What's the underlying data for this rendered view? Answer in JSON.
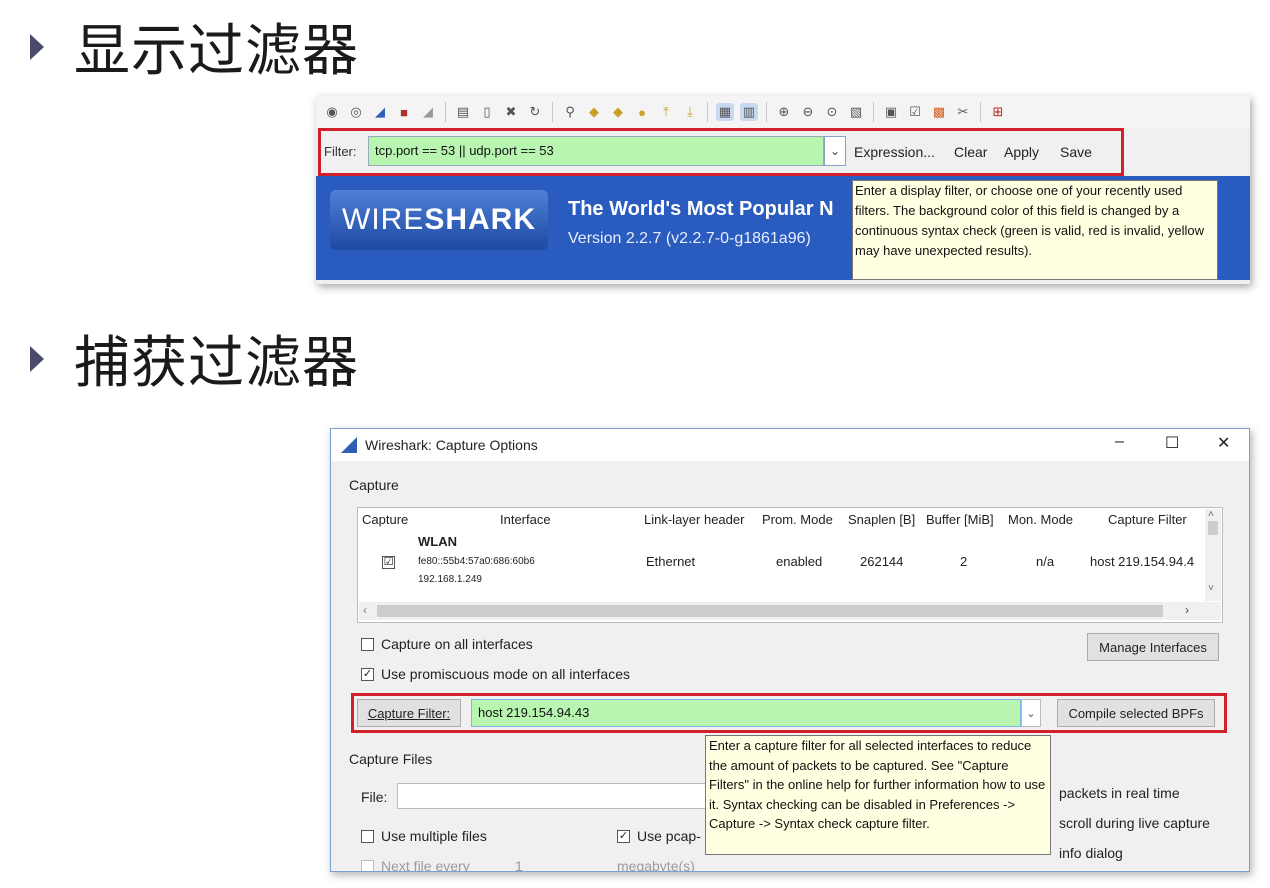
{
  "sections": {
    "display_filter_heading": "显示过滤器",
    "capture_filter_heading": "捕获过滤器"
  },
  "toolbar_icons": [
    "start-capture-icon",
    "options-icon",
    "shark-fin-icon",
    "stop-icon",
    "restart-icon",
    "open-file-icon",
    "file-icon",
    "close-file-icon",
    "reload-icon",
    "find-icon",
    "go-back-icon",
    "go-forward-icon",
    "go-to-packet-icon",
    "go-first-icon",
    "go-last-icon",
    "colorize-icon",
    "autoscroll-icon",
    "zoom-in-icon",
    "zoom-out-icon",
    "normal-size-icon",
    "resize-columns-icon",
    "capture-filters-icon",
    "display-filters-icon",
    "coloring-rules-icon",
    "preferences-icon",
    "help-icon"
  ],
  "display_filter_bar": {
    "label": "Filter:",
    "value": "tcp.port == 53 || udp.port == 53",
    "expression_button": "Expression...",
    "clear_button": "Clear",
    "apply_button": "Apply",
    "save_button": "Save",
    "valid_color": "#b8f5b0",
    "highlight_color": "#d0202a"
  },
  "welcome_banner": {
    "logo_part1": "WIRE",
    "logo_part2": "SHARK",
    "title": "The World's Most Popular N",
    "version": "Version 2.2.7 (v2.2.7-0-g1861a96)",
    "banner_color": "#2a5bbf"
  },
  "display_filter_tooltip": "Enter a display filter, or choose one of your recently used filters. The background color of this field is changed by a continuous syntax check (green is valid, red is invalid, yellow may have unexpected results).",
  "capture_options": {
    "window_title": "Wireshark: Capture Options",
    "minimize": "–",
    "maximize": "☐",
    "close": "✕",
    "capture_section": "Capture",
    "columns": [
      "Capture",
      "Interface",
      "Link-layer header",
      "Prom. Mode",
      "Snaplen [B]",
      "Buffer [MiB]",
      "Mon. Mode",
      "Capture Filter"
    ],
    "interface_row": {
      "checked": "☑",
      "name": "WLAN",
      "ipv6": "fe80::55b4:57a0:686:60b6",
      "ipv4": "192.168.1.249",
      "link_layer": "Ethernet",
      "prom_mode": "enabled",
      "snaplen": "262144",
      "buffer": "2",
      "mon_mode": "n/a",
      "capture_filter": "host 219.154.94.4"
    },
    "capture_all_interfaces": "Capture on all interfaces",
    "promiscuous_mode": "Use promiscuous mode on all interfaces",
    "manage_interfaces_button": "Manage Interfaces",
    "capture_filter_button": "Capture Filter:",
    "capture_filter_value": "host 219.154.94.43",
    "compile_bpfs_button": "Compile selected BPFs",
    "capture_files_section": "Capture Files",
    "file_label": "File:",
    "multiple_files": "Use multiple files",
    "pcap_ng": "Use pcap-",
    "next_file_every": "Next file every",
    "next_file_value": "1",
    "megabytes": "megabyte(s)",
    "packets_realtime": "packets in real time",
    "autoscroll": "scroll during live capture",
    "info_dialog": "info dialog",
    "tooltip": "Enter a capture filter for all selected interfaces to reduce the amount of packets to be captured. See \"Capture Filters\" in the online help for further information how to use it. Syntax checking can be disabled in Preferences -> Capture -> Syntax check capture filter."
  }
}
